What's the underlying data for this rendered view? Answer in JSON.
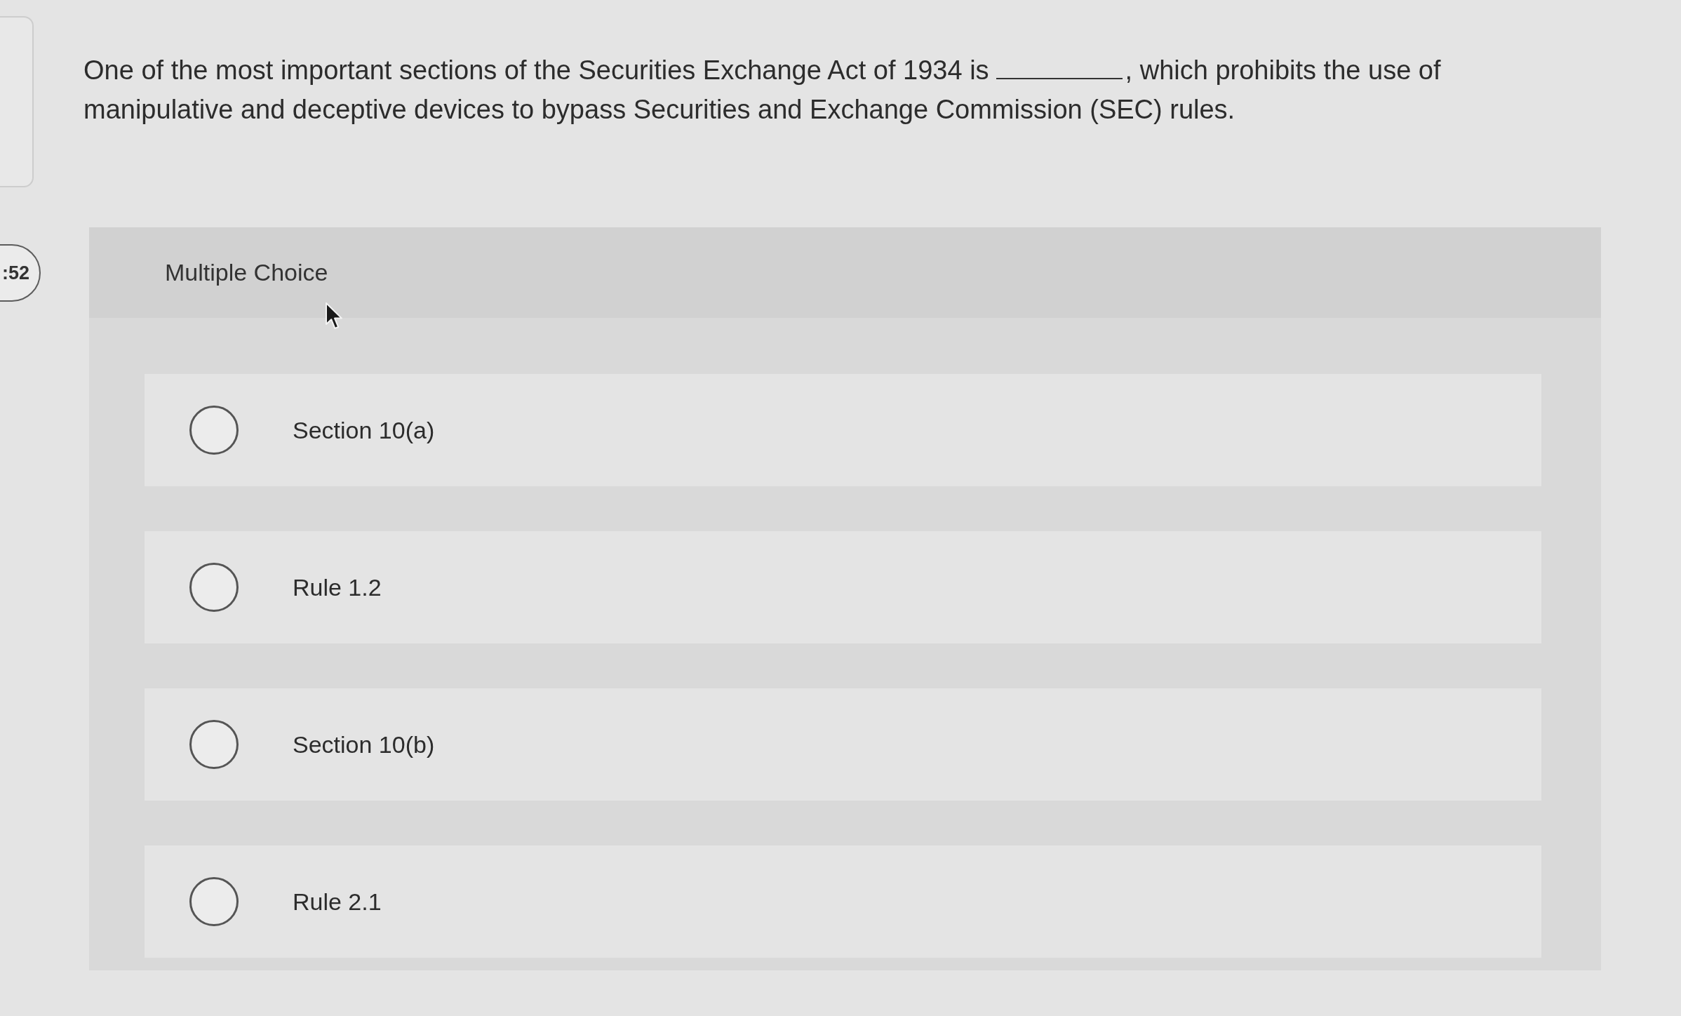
{
  "timer": {
    "text": ":52"
  },
  "question": {
    "segments": [
      {
        "kind": "text",
        "text": "One of the most important sections of the Securities Exchange Act of 1934 is"
      },
      {
        "kind": "blank"
      },
      {
        "kind": "text",
        "text": ", which prohibits the use of"
      },
      {
        "kind": "break"
      },
      {
        "kind": "text",
        "text": "manipulative and deceptive devices to bypass Securities and Exchange Commission (SEC) rules."
      }
    ]
  },
  "answer_area": {
    "title": "Multiple Choice",
    "options": [
      {
        "label": "Section 10(a)",
        "selected": false
      },
      {
        "label": "Rule 1.2",
        "selected": false
      },
      {
        "label": "Section 10(b)",
        "selected": false
      },
      {
        "label": "Rule 2.1",
        "selected": false
      }
    ]
  }
}
